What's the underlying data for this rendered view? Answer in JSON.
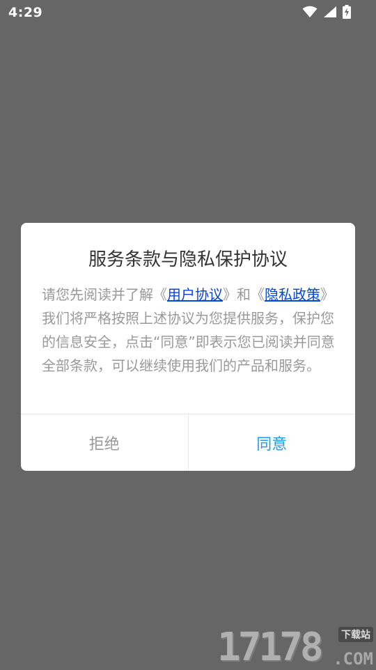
{
  "status_bar": {
    "time": "4:29"
  },
  "dialog": {
    "title": "服务条款与隐私保护协议",
    "body": {
      "part1": "请您先阅读并了解《",
      "link_user": "用户协议",
      "part2": "》和《",
      "link_privacy": "隐私政策",
      "part3": "》我们将严格按照上述协议为您提供服务，保护您的信息安全，点击“同意”即表示您已阅读并同意全部条款，可以继续使用我们的产品和服务。"
    },
    "reject_label": "拒绝",
    "agree_label": "同意"
  },
  "watermark": {
    "digits": "17178",
    "tag": "下载站",
    "suffix": ".COM"
  },
  "colors": {
    "overlay": "#666666",
    "agree": "#1e9bf0",
    "link": "#0645d8"
  }
}
